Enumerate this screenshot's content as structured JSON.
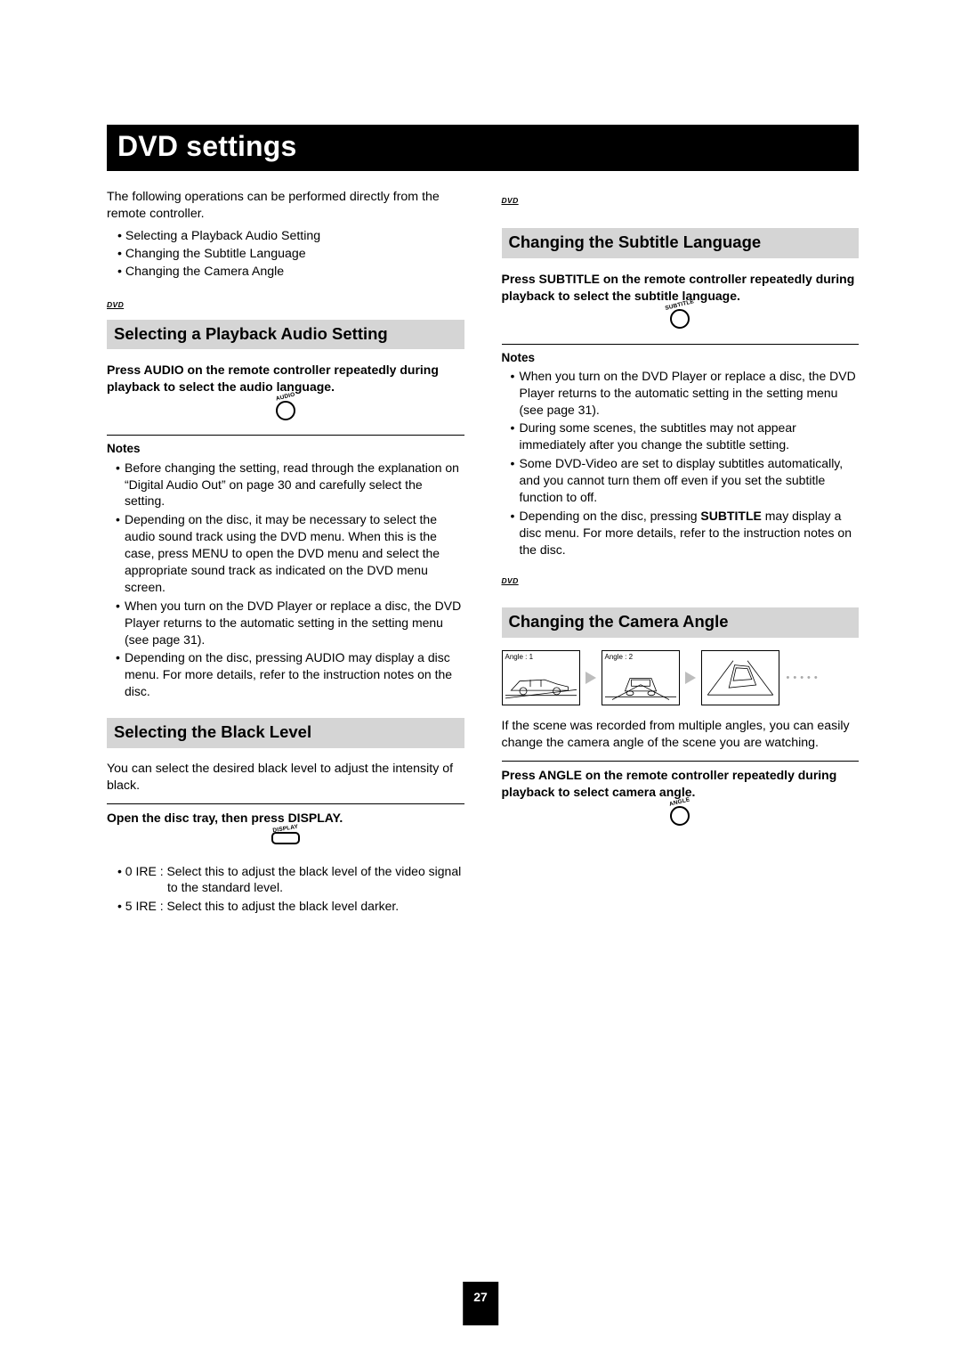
{
  "banner": "DVD settings",
  "intro": "The following operations can be performed directly from the remote controller.",
  "introList": [
    "Selecting a Playback Audio Setting",
    "Changing the Subtitle Language",
    "Changing the Camera Angle"
  ],
  "dvdBadge": "DVD",
  "pageNumber": "27",
  "audio": {
    "heading": "Selecting a Playback Audio Setting",
    "instr": "Press AUDIO on the remote controller repeatedly during playback to select the audio language.",
    "btnLabel": "AUDIO",
    "notesHead": "Notes",
    "notes": [
      "Before changing the setting, read through the explanation on “Digital Audio Out” on page 30 and carefully select the setting.",
      "Depending on the disc, it may be necessary to select the audio sound track using the DVD menu. When this is the case, press MENU to open the DVD menu and select the appropriate sound track as indicated on the DVD menu screen.",
      "When you turn on the DVD Player or replace a disc, the DVD Player returns to the automatic setting in the setting menu (see page 31).",
      "Depending on the disc, pressing AUDIO may display a disc menu. For more details, refer to the instruction notes on the disc."
    ]
  },
  "black": {
    "heading": "Selecting the Black Level",
    "desc": "You can select the desired black level to adjust the intensity of black.",
    "instr": "Open the disc tray, then press DISPLAY.",
    "btnLabel": "DISPLAY",
    "ire0": "• 0 IRE : Select this to adjust the black level of the video signal to the standard level.",
    "ire5": "• 5 IRE : Select this to adjust the black level darker."
  },
  "subtitle": {
    "heading": "Changing the Subtitle Language",
    "instr": "Press SUBTITLE on the remote controller repeatedly during playback to select the subtitle language.",
    "btnLabel": "SUBTITLE",
    "notesHead": "Notes",
    "note1": "When you turn on the DVD Player or replace a disc, the DVD Player returns to the automatic setting in the setting menu (see page 31).",
    "note2": "During some scenes, the subtitles may not appear immediately after you change the subtitle setting.",
    "note3": "Some DVD-Video are set to display subtitles automatically, and you cannot turn them off even if you set the subtitle function to off.",
    "note4a": "Depending on the disc, pressing ",
    "note4b": "SUBTITLE",
    "note4c": " may display a disc menu. For more details, refer to the instruction notes on the disc."
  },
  "angle": {
    "heading": "Changing the Camera Angle",
    "frame1": "Angle : 1",
    "frame2": "Angle : 2",
    "desc": "If the scene was recorded from multiple angles, you can easily change the camera angle of the scene you are watching.",
    "instr": "Press ANGLE on the remote controller repeatedly during playback to select camera angle.",
    "btnLabel": "ANGLE"
  }
}
